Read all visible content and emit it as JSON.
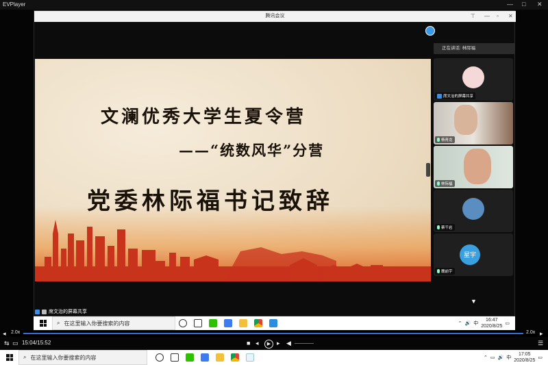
{
  "ev_player": {
    "title": "EVPlayer",
    "speed_left": "2.0x",
    "speed_right": "2.0x",
    "time_display": "15:04/15:52"
  },
  "meeting": {
    "title": "腾讯会议",
    "speaking_label": "正在讲话: 林际福"
  },
  "slide": {
    "title": "文澜优秀大学生夏令营",
    "subtitle": "——“统数风华”分营",
    "speech": "党委林际福书记致辞"
  },
  "share_caption": "席文治的屏幕共享",
  "participants": [
    {
      "name": "席文治的屏幕共享",
      "kind": "avatar"
    },
    {
      "name": "杨青龙",
      "kind": "video"
    },
    {
      "name": "林际福",
      "kind": "video"
    },
    {
      "name": "蔡千岩",
      "kind": "avatar"
    },
    {
      "name": "魏前宇",
      "kind": "text-avatar",
      "avatar_text": "星宇"
    }
  ],
  "inner_taskbar": {
    "search_placeholder": "在这里输入你要搜索的内容",
    "time": "16:47",
    "date": "2020/8/25",
    "ime": "中"
  },
  "outer_taskbar": {
    "search_placeholder": "在这里输入你要搜索的内容",
    "time": "17:05",
    "date": "2020/8/25",
    "ime": "中"
  },
  "colors": {
    "accent_blue": "#2f6fd8",
    "slide_text": "#1a1108",
    "skyline": "#c8331c"
  }
}
